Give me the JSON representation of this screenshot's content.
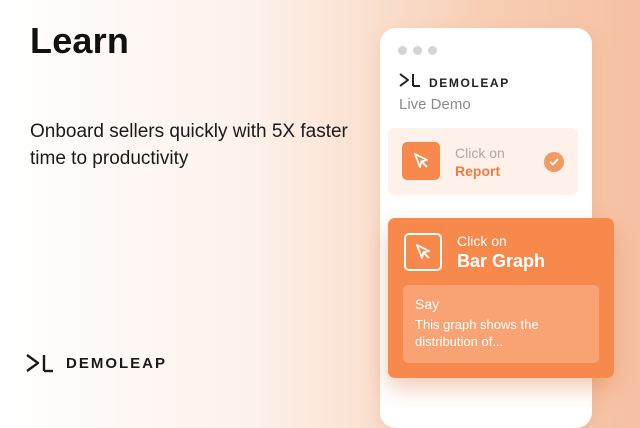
{
  "hero": {
    "title": "Learn",
    "subtitle": "Onboard sellers quickly with 5X faster time to productivity"
  },
  "brand": {
    "name": "DEMOLEAP",
    "logo_icon": "demoleap-logo-icon"
  },
  "panel": {
    "brand_name": "DEMOLEAP",
    "subtitle": "Live Demo",
    "step": {
      "line1": "Click on",
      "line2": "Report",
      "icon": "cursor-click-icon",
      "status_icon": "check-icon"
    }
  },
  "tooltip": {
    "line1": "Click on",
    "line2": "Bar Graph",
    "icon": "cursor-click-icon",
    "say_label": "Say",
    "say_text": "This graph shows the distribution of..."
  },
  "colors": {
    "accent": "#f7894d",
    "accent_light": "#f9a273",
    "accent_text": "#f07d3f",
    "step_bg": "#fdf1ea",
    "text_dark": "#111111",
    "muted": "#8b8b8b"
  }
}
